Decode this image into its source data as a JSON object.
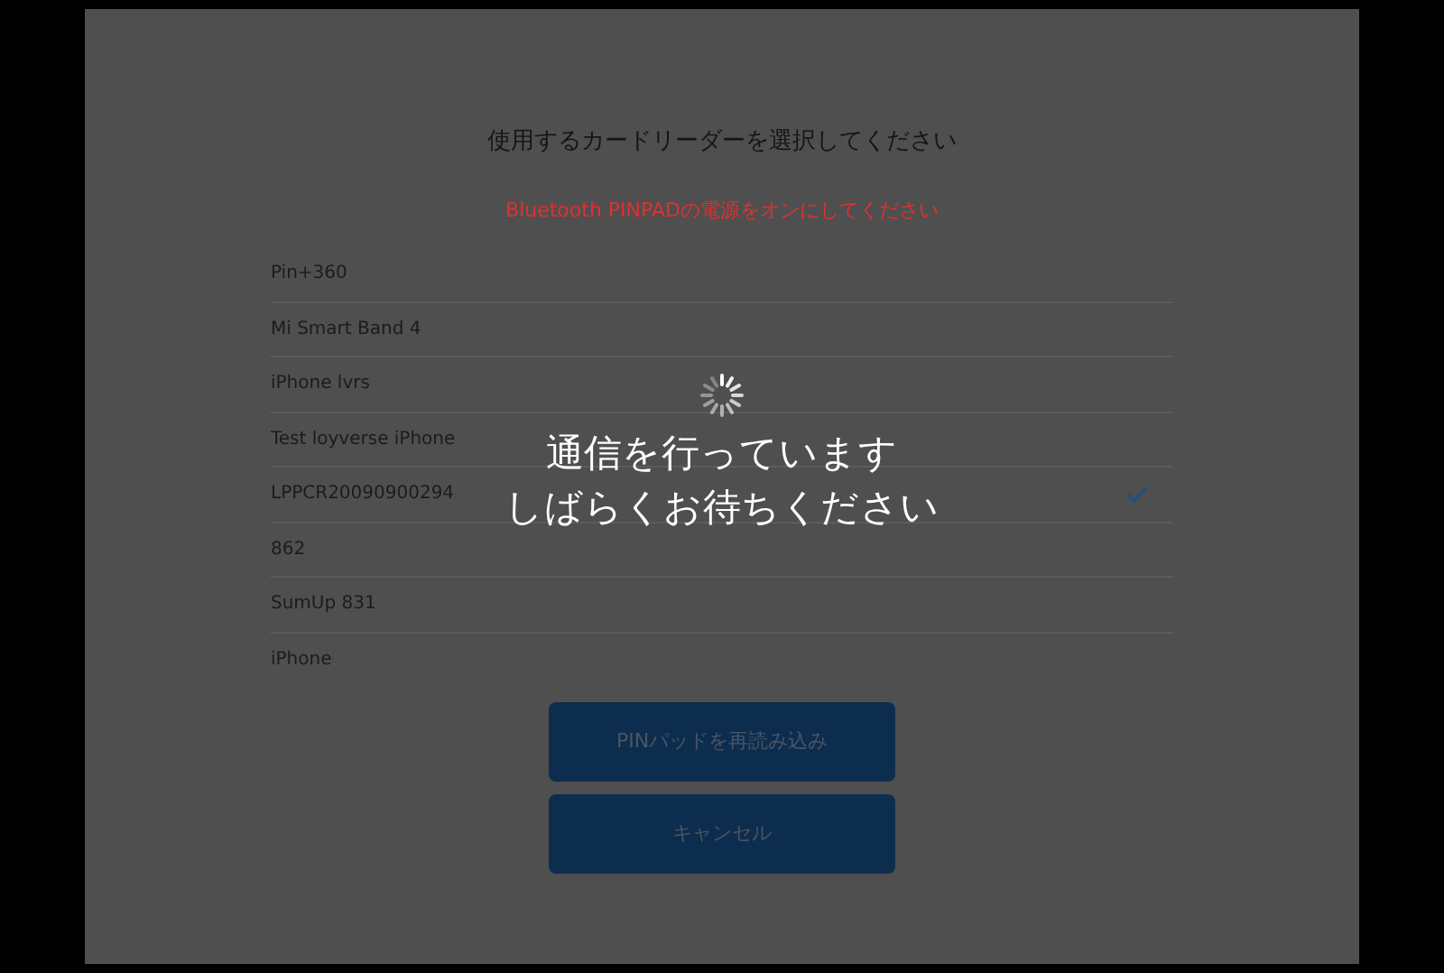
{
  "dialog": {
    "title": "使用するカードリーダーを選択してください",
    "warning": "Bluetooth PINPADの電源をオンにしてください",
    "readers": [
      {
        "name": "Pin+360",
        "selected": false
      },
      {
        "name": "Mi Smart Band 4",
        "selected": false
      },
      {
        "name": "iPhone lvrs",
        "selected": false
      },
      {
        "name": "Test loyverse iPhone",
        "selected": false
      },
      {
        "name": "LPPCR20090900294",
        "selected": true
      },
      {
        "name": "862",
        "selected": false
      },
      {
        "name": "SumUp 831",
        "selected": false
      },
      {
        "name": "iPhone",
        "selected": false
      }
    ],
    "buttons": [
      "PINパッドを再読み込み",
      "キャンセル"
    ]
  },
  "loading_overlay": {
    "message_lines": [
      "通信を行っています",
      "しばらくお待ちください"
    ]
  }
}
